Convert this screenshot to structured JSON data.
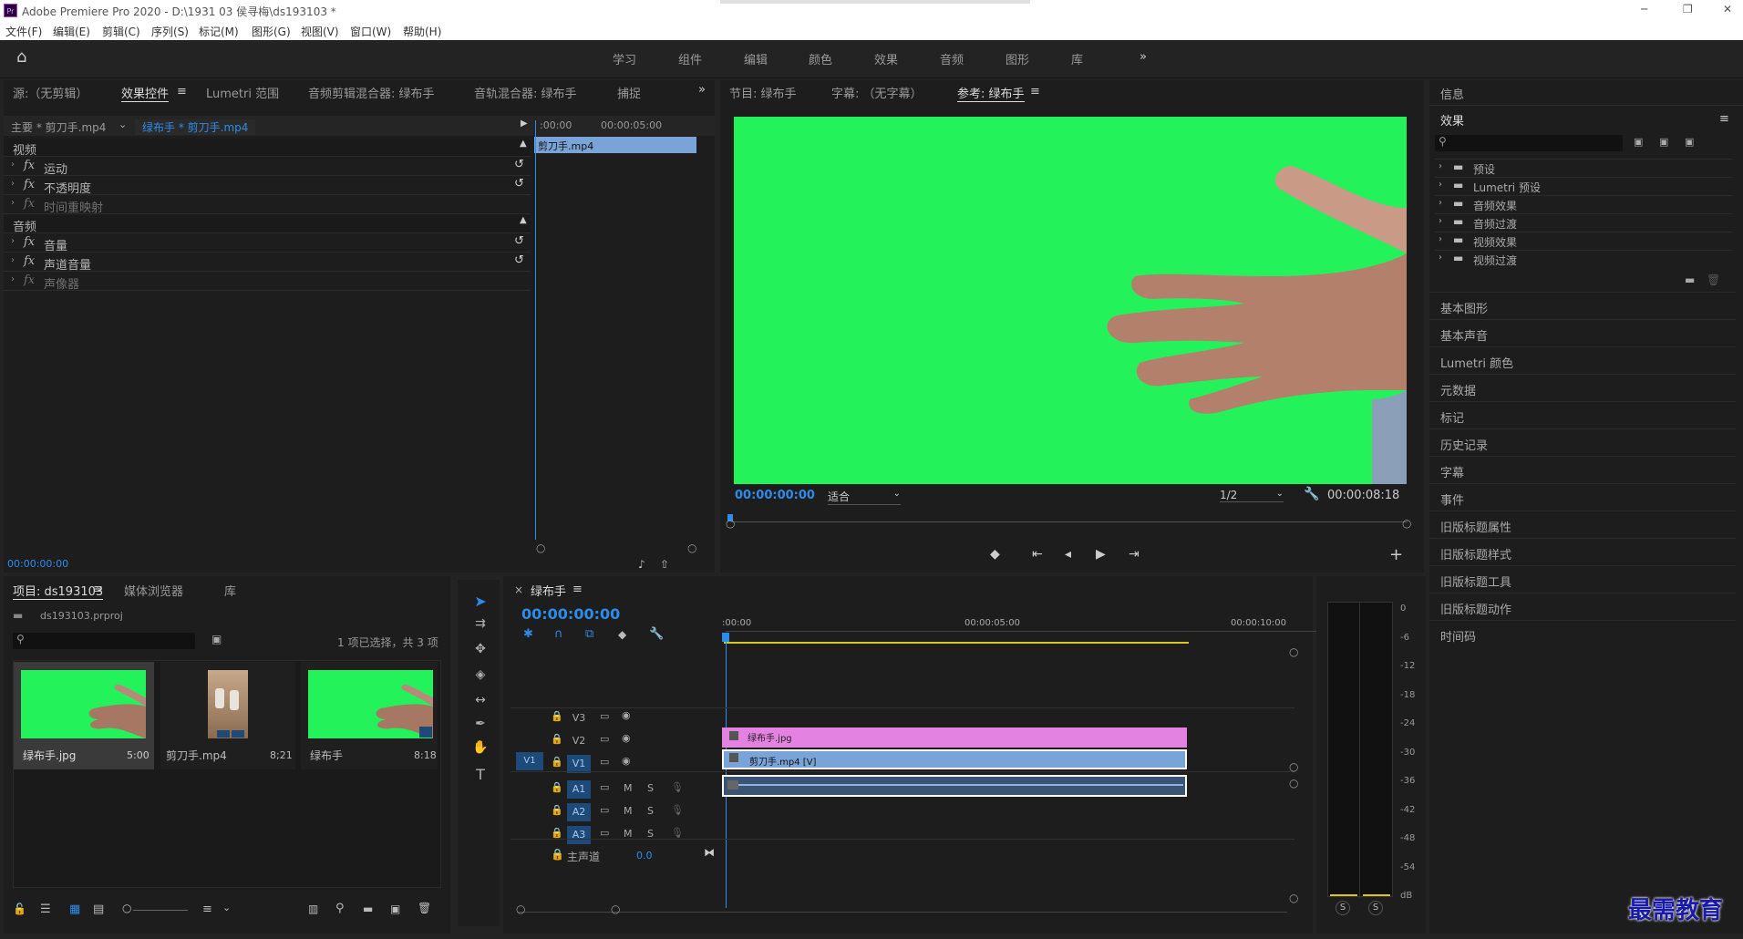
{
  "app": {
    "title": "Adobe Premiere Pro 2020 - D:\\1931 03 侯寻梅\\ds193103 *",
    "logo": "Pr"
  },
  "menu": [
    "文件(F)",
    "编辑(E)",
    "剪辑(C)",
    "序列(S)",
    "标记(M)",
    "图形(G)",
    "视图(V)",
    "窗口(W)",
    "帮助(H)"
  ],
  "workspaces": [
    "学习",
    "组件",
    "编辑",
    "颜色",
    "效果",
    "音频",
    "图形",
    "库"
  ],
  "source_panel": {
    "tabs": [
      "源:（无剪辑）",
      "效果控件",
      "Lumetri 范围",
      "音频剪辑混合器: 绿布手",
      "音轨混合器: 绿布手",
      "捕捉"
    ],
    "clip_master": "主要 * 剪刀手.mp4",
    "clip_seq": "绿布手 * 剪刀手.mp4",
    "tc_start": ":00:00",
    "tc_mid": "00:00:05:00",
    "clip_bar": "剪刀手.mp4",
    "sections": [
      {
        "kind": "header",
        "label": "视频"
      },
      {
        "kind": "fx",
        "label": "运动",
        "reset": true
      },
      {
        "kind": "fx",
        "label": "不透明度",
        "reset": true
      },
      {
        "kind": "fx",
        "label": "时间重映射",
        "reset": false,
        "dim": true
      },
      {
        "kind": "header",
        "label": "音频"
      },
      {
        "kind": "fx",
        "label": "音量",
        "reset": true
      },
      {
        "kind": "fx",
        "label": "声道音量",
        "reset": true
      },
      {
        "kind": "fx",
        "label": "声像器",
        "reset": false,
        "dim": true
      }
    ],
    "timecode": "00:00:00:00"
  },
  "program": {
    "tabs": [
      "节目: 绿布手",
      "字幕: （无字幕）",
      "参考: 绿布手"
    ],
    "timecode": "00:00:00:00",
    "fit": "适合",
    "resolution": "1/2",
    "duration": "00:00:08:18"
  },
  "right_panel": {
    "info_label": "信息",
    "effects_label": "效果",
    "tree": [
      "预设",
      "Lumetri 预设",
      "音频效果",
      "音频过渡",
      "视频效果",
      "视频过渡"
    ],
    "items": [
      "基本图形",
      "基本声音",
      "Lumetri 颜色",
      "元数据",
      "标记",
      "历史记录",
      "字幕",
      "事件",
      "旧版标题属性",
      "旧版标题样式",
      "旧版标题工具",
      "旧版标题动作",
      "时间码"
    ]
  },
  "project": {
    "tabs": [
      "项目: ds193103",
      "媒体浏览器",
      "库"
    ],
    "file": "ds193103.prproj",
    "selection": "1 项已选择，共 3 项",
    "items": [
      {
        "name": "绿布手.jpg",
        "dur": "5:00"
      },
      {
        "name": "剪刀手.mp4",
        "dur": "8;21"
      },
      {
        "name": "绿布手",
        "dur": "8:18"
      }
    ]
  },
  "timeline": {
    "tab": "绿布手",
    "timecode": "00:00:00:00",
    "ruler": [
      ":00:00",
      "00:00:05:00",
      "00:00:10:00"
    ],
    "video_tracks": [
      "V3",
      "V2",
      "V1"
    ],
    "source_patch": "V1",
    "audio_tracks": [
      "A1",
      "A2",
      "A3"
    ],
    "master": "主声道",
    "master_val": "0.0",
    "clip_v2": "绿布手.jpg",
    "clip_v1": "剪刀手.mp4 [V]",
    "m": "M",
    "s": "S"
  },
  "meter": {
    "ticks": [
      "0",
      "-6",
      "-12",
      "-18",
      "-24",
      "-30",
      "-36",
      "-42",
      "-48",
      "-54",
      "dB"
    ],
    "solo": [
      "S",
      "S"
    ]
  },
  "watermark": "最需教育",
  "colors": {
    "chroma_green": "#23f25b",
    "v2_clip": "#e482e2",
    "v1_clip": "#7aa3d8",
    "accent_blue": "#2d8ceb",
    "bin_blue": "#1e4a7a"
  }
}
